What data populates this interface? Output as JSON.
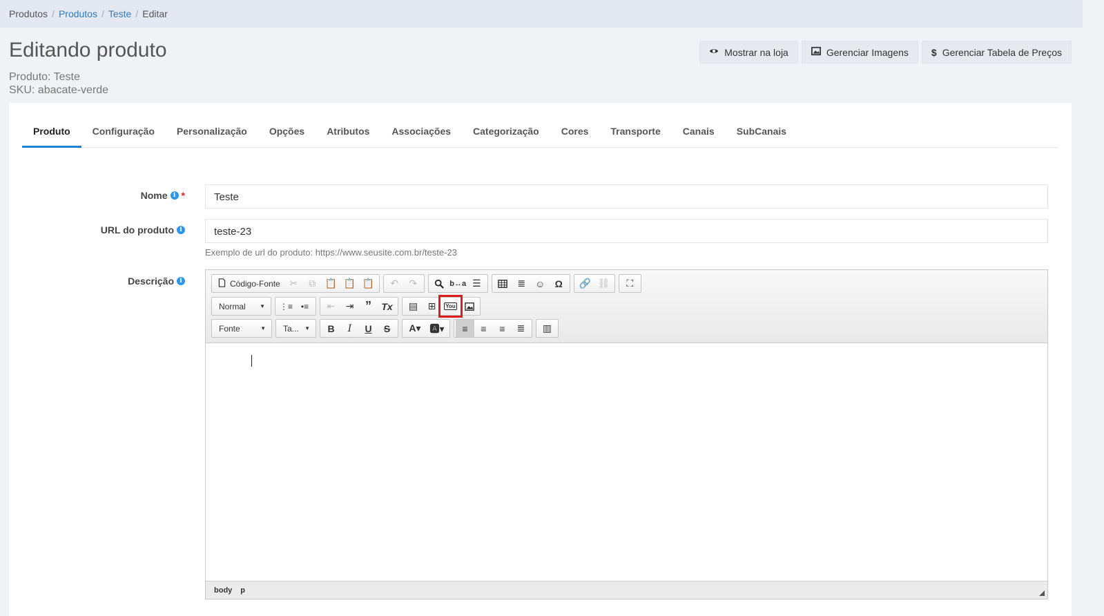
{
  "breadcrumb": {
    "items": [
      "Produtos",
      "Produtos",
      "Teste",
      "Editar"
    ]
  },
  "page": {
    "title": "Editando produto",
    "produto_line": "Produto: Teste",
    "sku_line": "SKU: abacate-verde"
  },
  "actions": {
    "show_store": "Mostrar na loja",
    "manage_images": "Gerenciar Imagens",
    "manage_prices": "Gerenciar Tabela de Preços"
  },
  "tabs": [
    "Produto",
    "Configuração",
    "Personalização",
    "Opções",
    "Atributos",
    "Associações",
    "Categorização",
    "Cores",
    "Transporte",
    "Canais",
    "SubCanais"
  ],
  "form": {
    "name_label": "Nome",
    "name_value": "Teste",
    "url_label": "URL do produto",
    "url_value": "teste-23",
    "url_hint": "Exemplo de url do produto: https://www.seusite.com.br/teste-23",
    "desc_label": "Descrição"
  },
  "editor": {
    "source_label": "Código-Fonte",
    "format_value": "Normal",
    "font_value": "Fonte",
    "size_value": "Ta...",
    "path": [
      "body",
      "p"
    ],
    "highlighted_button": "youtube-icon"
  },
  "colors": {
    "accent": "#1f7fd9",
    "highlight": "#e01b1b",
    "info": "#2e96e8"
  }
}
